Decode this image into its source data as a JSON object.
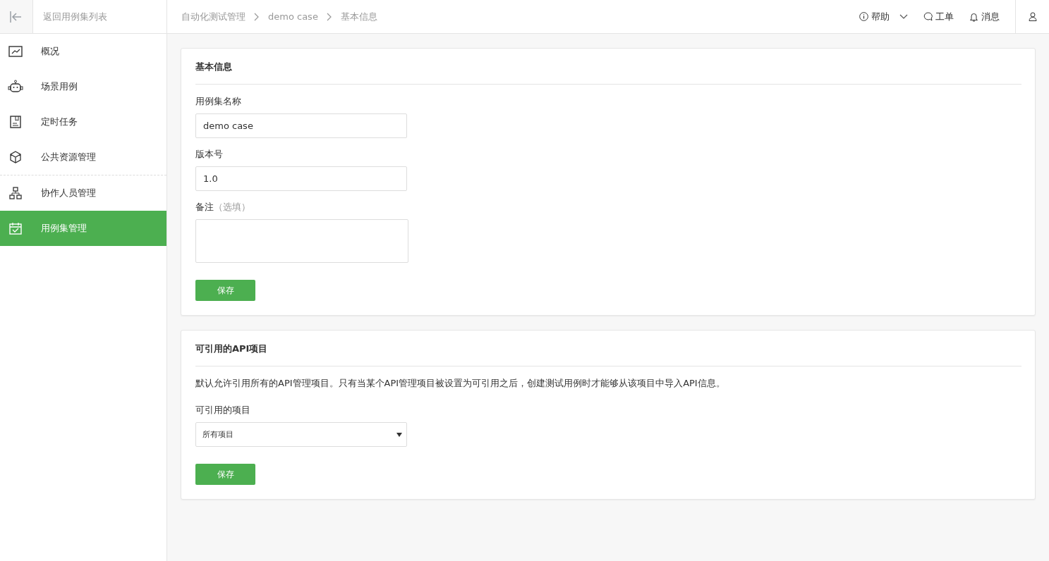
{
  "back_link": "返回用例集列表",
  "breadcrumb": [
    "自动化测试管理",
    "demo case",
    "基本信息"
  ],
  "top_actions": [
    {
      "kind": "help",
      "label": "帮助",
      "dropdown": true
    },
    {
      "kind": "ticket",
      "label": "工单",
      "dropdown": false
    },
    {
      "kind": "bell",
      "label": "消息",
      "dropdown": false
    }
  ],
  "sidebar": {
    "sections": [
      [
        {
          "kind": "chart",
          "label": "概况",
          "selected": false
        },
        {
          "kind": "robot",
          "label": "场景用例",
          "selected": false
        },
        {
          "kind": "doc",
          "label": "定时任务",
          "selected": false
        },
        {
          "kind": "cube",
          "label": "公共资源管理",
          "selected": false
        }
      ],
      [
        {
          "kind": "org",
          "label": "协作人员管理",
          "selected": false
        },
        {
          "kind": "calendar",
          "label": "用例集管理",
          "selected": true
        }
      ]
    ]
  },
  "basic_info": {
    "title": "基本信息",
    "fields": [
      {
        "kind": "input",
        "label": "用例集名称",
        "value": "demo case"
      },
      {
        "kind": "input",
        "label": "版本号",
        "value": "1.0"
      },
      {
        "kind": "textarea",
        "label": "备注",
        "note": "（选填）"
      }
    ],
    "button": "保存"
  },
  "api_projects": {
    "title": "可引用的API项目",
    "description": "默认允许引用所有的API管理项目。只有当某个API管理项目被设置为可引用之后，创建测试用例时才能够从该项目中导入API信息。",
    "select_label": "可引用的项目",
    "select_value": "所有项目",
    "button": "保存"
  }
}
